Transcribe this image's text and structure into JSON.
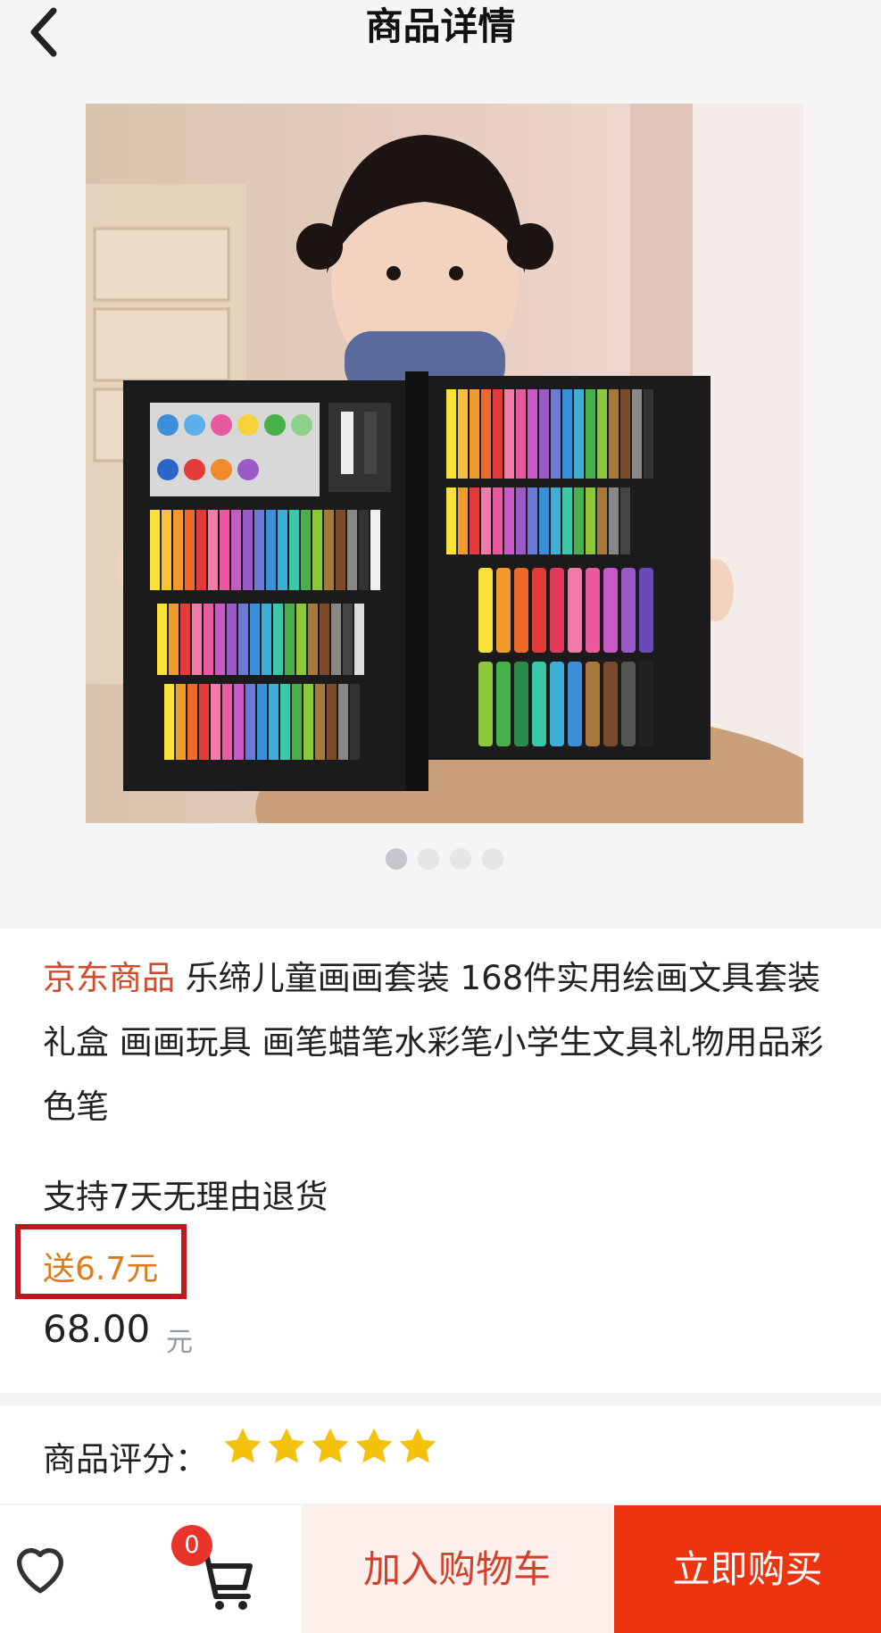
{
  "header": {
    "title": "商品详情",
    "back_icon": "chevron-left-icon"
  },
  "gallery": {
    "image_count": 4,
    "active_index": 0,
    "image_description_icon": "product-photo"
  },
  "product": {
    "brand_tag": "京东商品",
    "title": "乐缔儿童画画套装 168件实用绘画文具套装礼盒 画画玩具 画笔蜡笔水彩笔小学生文具礼物用品彩色笔",
    "returns": "支持7天无理由退货",
    "gift": "送6.7元",
    "price": "68.00",
    "price_unit": "元"
  },
  "rating": {
    "label": "商品评分：",
    "stars": 5,
    "max_stars": 5
  },
  "bottom_bar": {
    "favorite_icon": "heart-icon",
    "cart_icon": "cart-icon",
    "cart_count": "0",
    "add_to_cart": "加入购物车",
    "buy_now": "立即购买"
  },
  "colors": {
    "brand_red": "#d04a2c",
    "gift_orange": "#e07a16",
    "highlight_border": "#c0171f",
    "buy_button": "#ec3510",
    "add_cart_bg": "#fdf0ec",
    "star_yellow": "#f4c20d"
  }
}
